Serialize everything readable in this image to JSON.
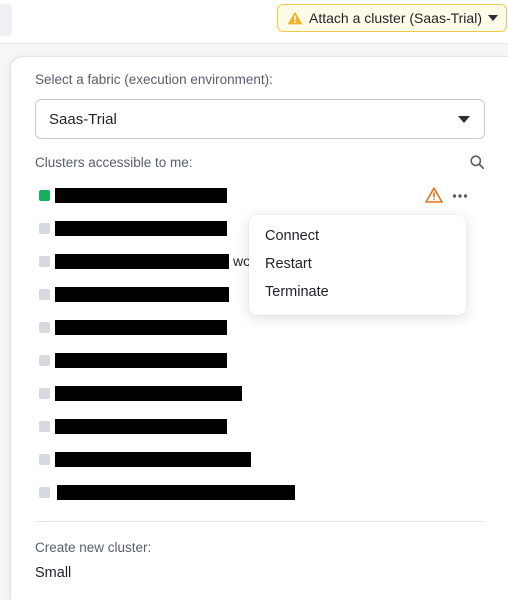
{
  "toolbar": {
    "attach_button_label": "Attach a cluster (Saas-Trial)",
    "warning_color": "#f2c94c"
  },
  "fabric": {
    "label": "Select a fabric (execution environment):",
    "selected": "Saas-Trial"
  },
  "clusters": {
    "label": "Clusters accessible to me:",
    "items": [
      {
        "status": "active",
        "status_color": "#14ae5c",
        "name_redacted": true,
        "suffix": ""
      },
      {
        "status": "inactive",
        "status_color": "#d6d9de",
        "name_redacted": true,
        "suffix": ""
      },
      {
        "status": "inactive",
        "status_color": "#d6d9de",
        "name_redacted": true,
        "suffix": "wo"
      },
      {
        "status": "inactive",
        "status_color": "#d6d9de",
        "name_redacted": true,
        "suffix": ""
      },
      {
        "status": "inactive",
        "status_color": "#d6d9de",
        "name_redacted": true,
        "suffix": ""
      },
      {
        "status": "inactive",
        "status_color": "#d6d9de",
        "name_redacted": true,
        "suffix": ""
      },
      {
        "status": "inactive",
        "status_color": "#d6d9de",
        "name_redacted": true,
        "suffix": ""
      },
      {
        "status": "inactive",
        "status_color": "#d6d9de",
        "name_redacted": true,
        "suffix": ""
      },
      {
        "status": "inactive",
        "status_color": "#d6d9de",
        "name_redacted": true,
        "suffix": ""
      },
      {
        "status": "inactive",
        "status_color": "#d6d9de",
        "name_redacted": true,
        "suffix": ""
      }
    ]
  },
  "context_menu": {
    "items": [
      "Connect",
      "Restart",
      "Terminate"
    ]
  },
  "create_cluster": {
    "label": "Create new cluster:",
    "value": "Small"
  },
  "icons": {
    "warning": "warning-triangle-icon",
    "more": "more-horizontal-icon",
    "search": "search-icon",
    "caret": "chevron-down-icon"
  }
}
